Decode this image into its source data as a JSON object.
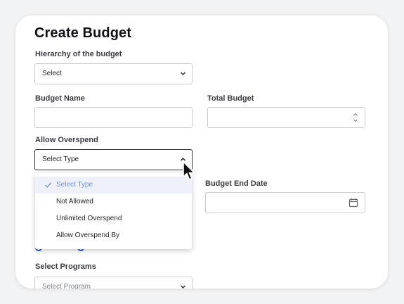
{
  "form": {
    "title": "Create Budget",
    "hierarchy_label": "Hierarchy of the budget",
    "hierarchy_value": "Select",
    "budget_name_label": "Budget Name",
    "budget_name_value": "",
    "total_budget_label": "Total Budget",
    "total_budget_value": "",
    "allow_overspend_label": "Allow Overspend",
    "allow_overspend_value": "Select Type",
    "budget_end_date_label": "Budget End Date",
    "budget_end_date_value": "",
    "select_programs_label": "Select Programs",
    "select_programs_value": "Select Program"
  },
  "dropdown": {
    "options": [
      {
        "label": "Select Type",
        "selected": true
      },
      {
        "label": "Not Allowed",
        "selected": false
      },
      {
        "label": "Unlimited Overspend",
        "selected": false
      },
      {
        "label": "Allow Overspend By",
        "selected": false
      }
    ]
  },
  "icons": {
    "select_chevron": "chevron-down-icon",
    "open_chevron": "chevron-up-icon",
    "stepper": "stepper-arrows-icon",
    "date": "calendar-icon",
    "selected_option": "check-icon",
    "pointer": "mouse-cursor-icon"
  },
  "colors": {
    "accent": "#1f5fcf",
    "selected_option_text": "#6f8fd8",
    "selected_option_bg": "#eef1f8",
    "card_bg": "#ffffff",
    "page_bg": "#f2f3f4"
  }
}
